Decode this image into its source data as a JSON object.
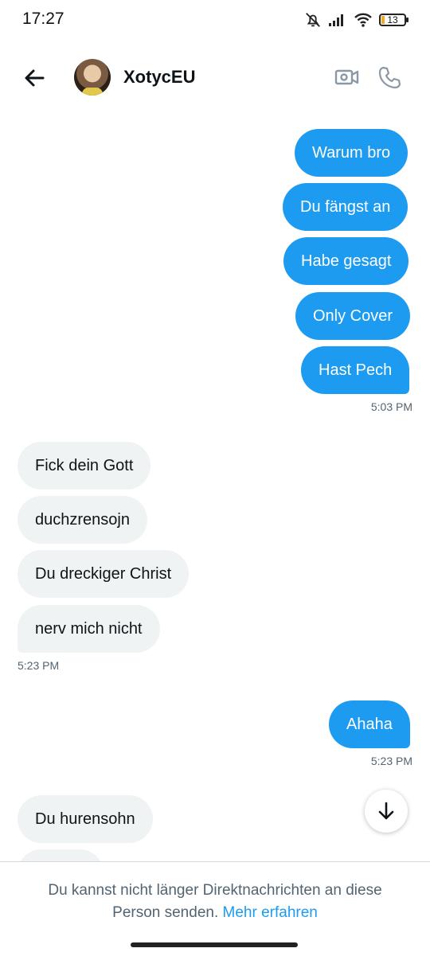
{
  "status_bar": {
    "time": "17:27",
    "battery": "13"
  },
  "header": {
    "contact_name": "XotycEU"
  },
  "messages": [
    {
      "text": "Warum bro"
    },
    {
      "text": "Du fängst an"
    },
    {
      "text": "Habe gesagt"
    },
    {
      "text": "Only Cover"
    },
    {
      "text": "Hast Pech"
    },
    {
      "timestamp": "5:03 PM"
    },
    {
      "text": "Fick dein Gott"
    },
    {
      "text": "duchzrensojn"
    },
    {
      "text": "Du dreckiger Christ"
    },
    {
      "text": "nerv mich nicht"
    },
    {
      "timestamp": "5:23 PM"
    },
    {
      "text": "Ahaha"
    },
    {
      "timestamp": "5:23 PM"
    },
    {
      "text": "Du hurensohn"
    }
  ],
  "footer": {
    "notice": "Du kannst nicht länger Direktnachrichten an diese Person senden.",
    "link": "Mehr erfahren"
  },
  "colors": {
    "accent": "#1d9bf0",
    "incoming_bubble": "#eff3f4"
  }
}
